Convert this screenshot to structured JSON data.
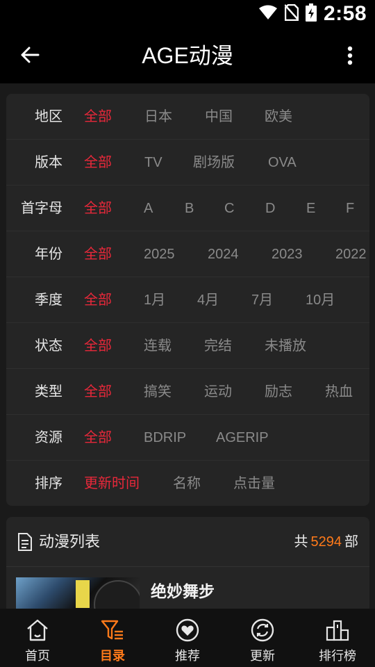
{
  "status": {
    "time": "2:58"
  },
  "appbar": {
    "title": "AGE动漫"
  },
  "filters": [
    {
      "label": "地区",
      "options": [
        "全部",
        "日本",
        "中国",
        "欧美"
      ]
    },
    {
      "label": "版本",
      "options": [
        "全部",
        "TV",
        "剧场版",
        "OVA"
      ]
    },
    {
      "label": "首字母",
      "options": [
        "全部",
        "A",
        "B",
        "C",
        "D",
        "E",
        "F"
      ]
    },
    {
      "label": "年份",
      "options": [
        "全部",
        "2025",
        "2024",
        "2023",
        "2022"
      ]
    },
    {
      "label": "季度",
      "options": [
        "全部",
        "1月",
        "4月",
        "7月",
        "10月"
      ]
    },
    {
      "label": "状态",
      "options": [
        "全部",
        "连载",
        "完结",
        "未播放"
      ]
    },
    {
      "label": "类型",
      "options": [
        "全部",
        "搞笑",
        "运动",
        "励志",
        "热血"
      ]
    },
    {
      "label": "资源",
      "options": [
        "全部",
        "BDRIP",
        "AGERIP"
      ]
    },
    {
      "label": "排序",
      "options": [
        "更新时间",
        "名称",
        "点击量"
      ]
    }
  ],
  "list": {
    "title": "动漫列表",
    "count_prefix": "共",
    "count": "5294",
    "count_suffix": "部",
    "items": [
      {
        "title": "绝妙舞步"
      }
    ]
  },
  "nav": [
    {
      "label": "首页",
      "icon": "home-icon"
    },
    {
      "label": "目录",
      "icon": "filter-icon"
    },
    {
      "label": "推荐",
      "icon": "heart-icon"
    },
    {
      "label": "更新",
      "icon": "refresh-icon"
    },
    {
      "label": "排行榜",
      "icon": "podium-icon"
    }
  ],
  "colors": {
    "accent_red": "#e8283a",
    "accent_orange": "#ff7a1a"
  }
}
